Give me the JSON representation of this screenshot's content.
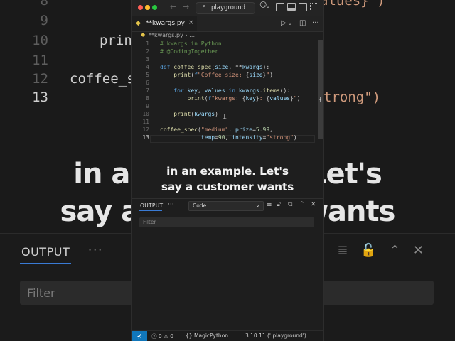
{
  "background": {
    "lines": [
      {
        "n": "8",
        "text": "",
        "right_text": "alues}\")"
      },
      {
        "n": "9",
        "text": ""
      },
      {
        "n": "10",
        "text": "prin"
      },
      {
        "n": "11",
        "text": ""
      },
      {
        "n": "12",
        "text": "coffee_spe"
      },
      {
        "n": "13",
        "text": "",
        "right_text": "trong\")"
      }
    ],
    "caption_line1": "in an example. Let's",
    "caption_line2": "say a customer wants",
    "output_label": "OUTPUT",
    "filter_placeholder": "Filter"
  },
  "window": {
    "search_label": "playground",
    "traffic_lights": {
      "close": "#ff5f57",
      "minimize": "#febc2e",
      "maximize": "#28c840"
    }
  },
  "tab": {
    "name": "**kwargs.py",
    "close_glyph": "×"
  },
  "breadcrumb": {
    "file": "**kwargs.py",
    "sep": "›",
    "more": "…"
  },
  "editor": {
    "current_line": "13",
    "lines": [
      {
        "n": "1",
        "html": "<span class='cm'># kwargs in Python</span>"
      },
      {
        "n": "2",
        "html": "<span class='cm'># @CodingTogether</span>"
      },
      {
        "n": "3",
        "html": ""
      },
      {
        "n": "4",
        "html": "<span class='kw'>def</span> <span class='fn'>coffee_spec</span>(<span class='pm'>size</span>, **<span class='pm'>kwargs</span>):"
      },
      {
        "n": "5",
        "html": "    <span class='fn'>print</span>(<span class='kw'>f</span><span class='st'>\"Coffee size: </span>{<span class='pm'>size</span>}<span class='st'>\"</span>)"
      },
      {
        "n": "6",
        "html": ""
      },
      {
        "n": "7",
        "html": "    <span class='kw'>for</span> <span class='pm'>key</span>, <span class='pm'>values</span> <span class='kw'>in</span> <span class='pm'>kwargs</span>.<span class='fn'>items</span>():"
      },
      {
        "n": "8",
        "html": "        <span class='fn'>print</span>(<span class='kw'>f</span><span class='st'>\"kwargs: </span>{<span class='pm'>key</span>}<span class='st'>: </span>{<span class='pm'>values</span>}<span class='st'>\"</span>)"
      },
      {
        "n": "9",
        "html": ""
      },
      {
        "n": "10",
        "html": "    <span class='fn'>print</span>(<span class='pm'>kwargs</span>)"
      },
      {
        "n": "11",
        "html": ""
      },
      {
        "n": "12",
        "html": "<span class='fn'>coffee_spec</span>(<span class='st'>\"medium\"</span>, <span class='pm'>prize</span>=<span class='nm'>5.99</span>,"
      },
      {
        "n": "13",
        "html": "            <span class='pm'>temp</span>=<span class='nm'>90</span>, <span class='pm'>intensity</span>=<span class='st'>\"strong\"</span>)"
      }
    ]
  },
  "caption": {
    "line1": "in an example. Let's",
    "line2": "say a customer wants"
  },
  "panel": {
    "tab_label": "OUTPUT",
    "more": "···",
    "channel": "Code",
    "filter_placeholder": "Filter"
  },
  "statusbar": {
    "remote_glyph": "⊀",
    "errors": "0",
    "warnings": "0",
    "braces": "{}",
    "language": "MagicPython",
    "interpreter": "3.10.11 ('.playground')"
  }
}
